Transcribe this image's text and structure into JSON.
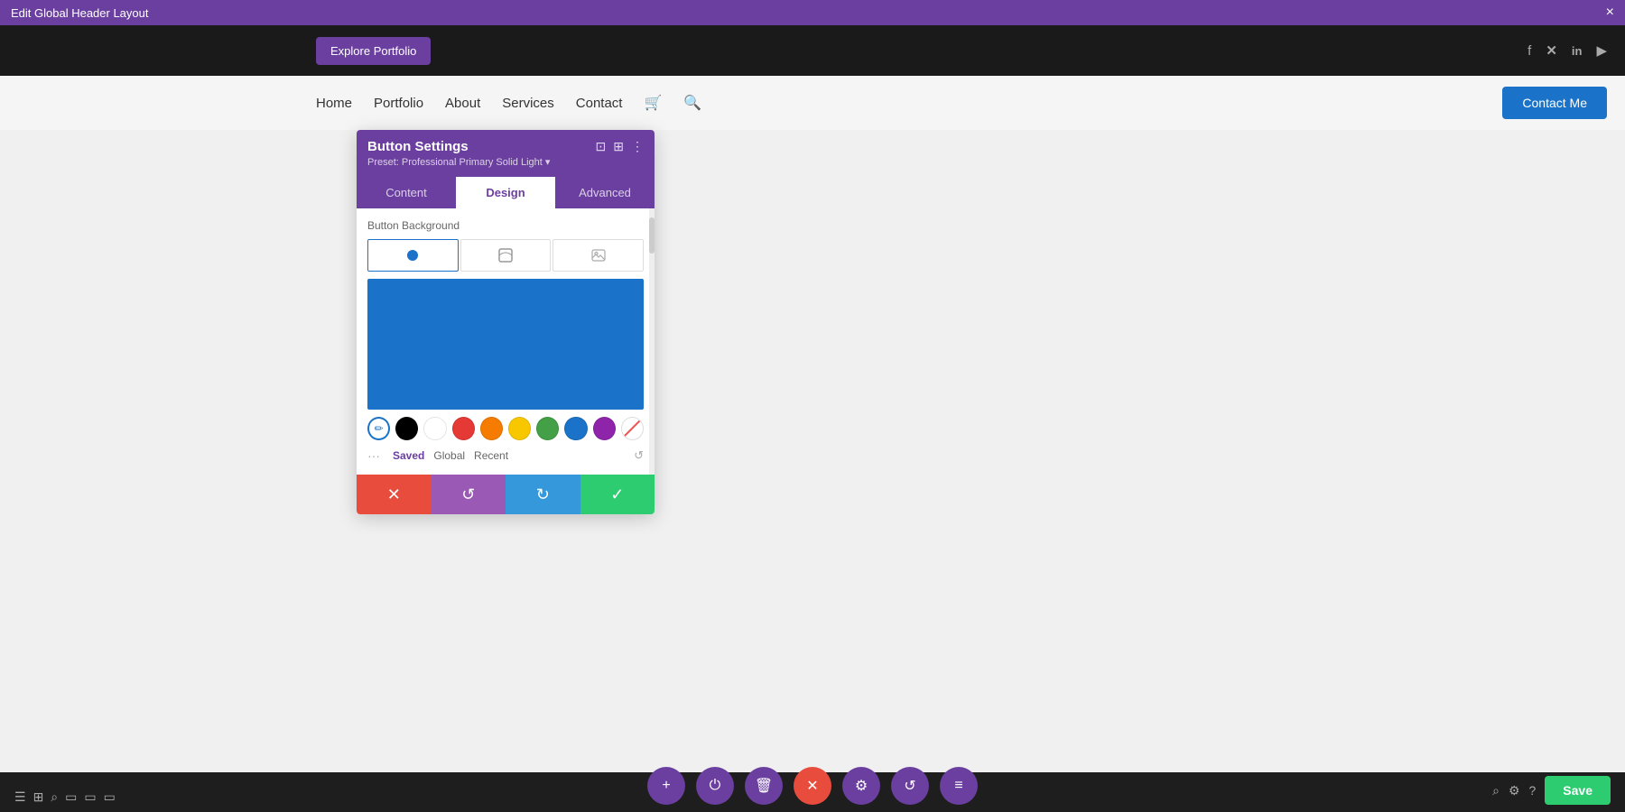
{
  "topBar": {
    "title": "Edit Global Header Layout",
    "closeLabel": "×"
  },
  "siteHeaderTop": {
    "exploreBtn": "Explore Portfolio",
    "socialIcons": [
      "f",
      "𝕏",
      "in",
      "▶"
    ]
  },
  "siteNav": {
    "links": [
      "Home",
      "Portfolio",
      "About",
      "Services",
      "Contact"
    ],
    "contactBtn": "Contact Me"
  },
  "panel": {
    "title": "Button Settings",
    "preset": "Preset: Professional Primary Solid Light ▾",
    "tabs": [
      "Content",
      "Design",
      "Advanced"
    ],
    "activeTab": "Design",
    "sectionLabel": "Button Background",
    "colorTabs": [
      "Saved",
      "Global",
      "Recent"
    ]
  },
  "footerButtons": {
    "cancel": "✕",
    "undo": "↺",
    "redo": "↻",
    "confirm": "✓"
  },
  "bottomBar": {
    "leftIcons": [
      "☰",
      "⊞",
      "🔍",
      "□",
      "□",
      "□"
    ],
    "centerActions": [
      "+",
      "⏻",
      "🗑",
      "✕",
      "⚙",
      "↺",
      "≡"
    ],
    "rightIcons": [
      "🔍",
      "⚙",
      "?"
    ],
    "saveLabel": "Save"
  }
}
